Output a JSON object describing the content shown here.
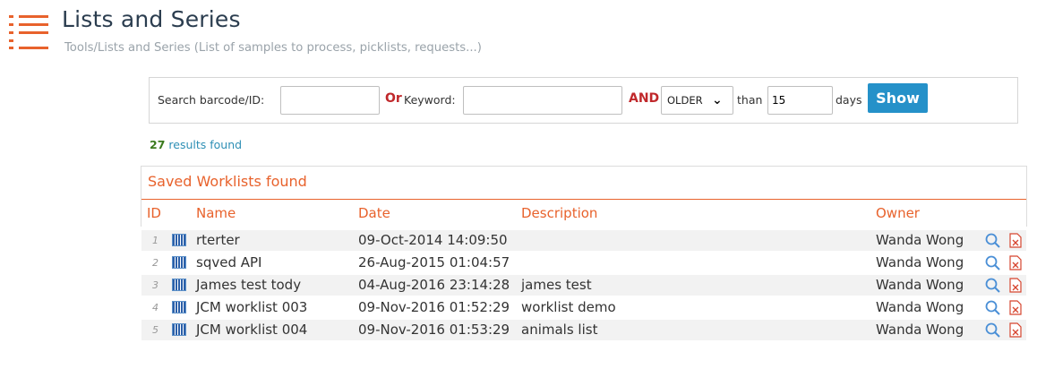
{
  "header": {
    "title": "Lists and Series",
    "subtitle": "Tools/Lists and Series (List of samples to process, picklists, requests...)"
  },
  "search": {
    "barcode_label": "Search barcode/ID:",
    "barcode_value": "",
    "or_label": "Or",
    "keyword_label": "Keyword:",
    "keyword_value": "",
    "and_label": "AND",
    "age_select": "OLDER",
    "than_label": "than",
    "days_value": "15",
    "days_label": "days",
    "show_button": "Show"
  },
  "results": {
    "count": "27",
    "label": "results found"
  },
  "worklists": {
    "title": "Saved Worklists found",
    "columns": {
      "id": "ID",
      "name": "Name",
      "date": "Date",
      "description": "Description",
      "owner": "Owner"
    },
    "rows": [
      {
        "id": "1",
        "name": "rterter",
        "date": "09-Oct-2014 14:09:50",
        "description": "",
        "owner": "Wanda Wong"
      },
      {
        "id": "2",
        "name": "sqved API",
        "date": "26-Aug-2015 01:04:57",
        "description": "",
        "owner": "Wanda Wong"
      },
      {
        "id": "3",
        "name": "James test tody",
        "date": "04-Aug-2016 23:14:28",
        "description": "james test",
        "owner": "Wanda Wong"
      },
      {
        "id": "4",
        "name": "JCM worklist 003",
        "date": "09-Nov-2016 01:52:29",
        "description": "worklist demo",
        "owner": "Wanda Wong"
      },
      {
        "id": "5",
        "name": "JCM worklist 004",
        "date": "09-Nov-2016 01:53:29",
        "description": "animals list",
        "owner": "Wanda Wong"
      }
    ]
  },
  "icons": {
    "header": "list-icon",
    "row_type": "barcode-icon",
    "view": "magnifier-icon",
    "delete": "pdf-delete-icon"
  },
  "colors": {
    "accent": "#e8622c",
    "title": "#2b3d4f",
    "button": "#2591c9",
    "operator": "#c0282b",
    "results_link": "#2e8fb5",
    "row_alt": "#f2f2f2"
  }
}
